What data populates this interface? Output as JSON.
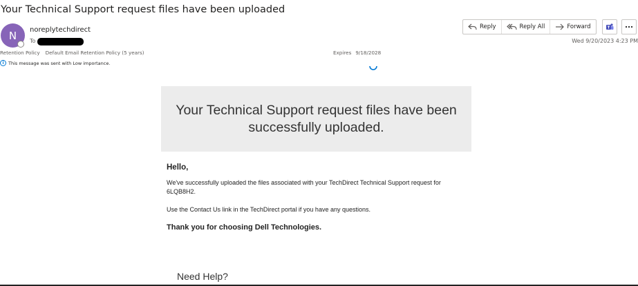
{
  "message": {
    "subject": "Your Technical Support request files have been uploaded",
    "avatar_initial": "N",
    "sender": "noreplytechdirect",
    "to_label": "To",
    "retention_label": "Retention Policy",
    "retention_value": "Default Email Retention Policy (5 years)",
    "expires_label": "Expires",
    "expires_value": "9/18/2028",
    "importance_note": "This message was sent with Low importance.",
    "date": "Wed 9/20/2023 4:23 PM"
  },
  "actions": {
    "reply": "Reply",
    "reply_all": "Reply All",
    "forward": "Forward",
    "teams_icon": "teams-icon",
    "more_icon": "more-icon"
  },
  "email_body": {
    "banner": "Your Technical Support request files have been successfully uploaded.",
    "greeting": "Hello,",
    "paragraph1": "We've successfully uploaded the files associated with your TechDirect Technical Support request for 6LQB8H2.",
    "paragraph2": "Use the Contact Us link in the TechDirect portal if you have any questions.",
    "thanks": "Thank you for choosing Dell Technologies.",
    "help_heading": "Need Help?"
  },
  "colors": {
    "avatar": "#8764b8",
    "accent": "#0078d4",
    "teams": "#4b53bc",
    "banner_bg": "#ececec"
  }
}
